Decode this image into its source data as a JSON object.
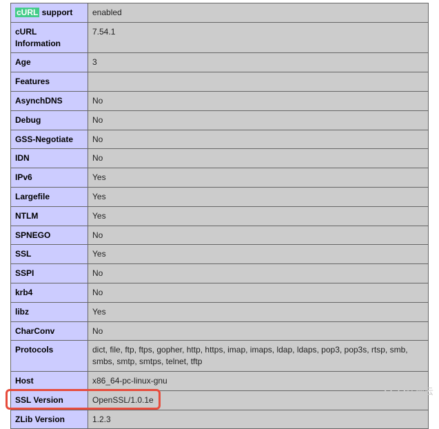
{
  "rows": [
    {
      "label_html": "<span class='highlight-green'>cURL</span> support",
      "label": "cURL support",
      "value": "enabled"
    },
    {
      "label": "cURL Information",
      "value": "7.54.1"
    },
    {
      "label": "Age",
      "value": "3"
    },
    {
      "label": "Features",
      "value": ""
    },
    {
      "label": "AsynchDNS",
      "value": "No"
    },
    {
      "label": "Debug",
      "value": "No"
    },
    {
      "label": "GSS-Negotiate",
      "value": "No"
    },
    {
      "label": "IDN",
      "value": "No"
    },
    {
      "label": "IPv6",
      "value": "Yes"
    },
    {
      "label": "Largefile",
      "value": "Yes"
    },
    {
      "label": "NTLM",
      "value": "Yes"
    },
    {
      "label": "SPNEGO",
      "value": "No"
    },
    {
      "label": "SSL",
      "value": "Yes"
    },
    {
      "label": "SSPI",
      "value": "No"
    },
    {
      "label": "krb4",
      "value": "No"
    },
    {
      "label": "libz",
      "value": "Yes"
    },
    {
      "label": "CharConv",
      "value": "No"
    },
    {
      "label": "Protocols",
      "value": "dict, file, ftp, ftps, gopher, http, https, imap, imaps, ldap, ldaps, pop3, pop3s, rtsp, smb, smbs, smtp, smtps, telnet, tftp"
    },
    {
      "label": "Host",
      "value": "x86_64-pc-linux-gnu"
    },
    {
      "label": "SSL Version",
      "value": "OpenSSL/1.0.1e",
      "highlighted": true
    },
    {
      "label": "ZLib Version",
      "value": "1.2.3"
    }
  ],
  "watermark": "亿速云"
}
